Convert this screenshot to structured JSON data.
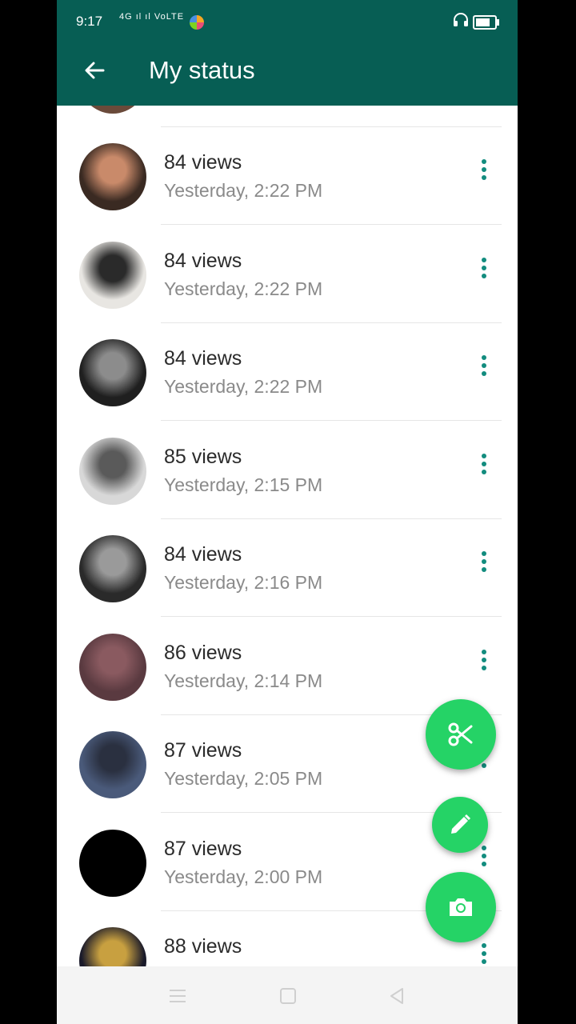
{
  "status_bar": {
    "time": "9:17",
    "signal_text": "4G ıl ıl VoLTE",
    "icons": [
      "signal-icon",
      "app-notification-icon",
      "headset-icon",
      "battery-icon"
    ]
  },
  "app_bar": {
    "title": "My status",
    "back_icon": "arrow-left-icon"
  },
  "statuses": [
    {
      "views": "84 views",
      "time": "Yesterday, 2:22 PM",
      "avatar_colors": [
        "#3a2a22",
        "#c98a6a"
      ]
    },
    {
      "views": "84 views",
      "time": "Yesterday, 2:22 PM",
      "avatar_colors": [
        "#e8e6e2",
        "#2a2a2a"
      ]
    },
    {
      "views": "84 views",
      "time": "Yesterday, 2:22 PM",
      "avatar_colors": [
        "#1f1f1f",
        "#8c8c8c"
      ]
    },
    {
      "views": "85 views",
      "time": "Yesterday, 2:15 PM",
      "avatar_colors": [
        "#d8d8d8",
        "#5a5a5a"
      ]
    },
    {
      "views": "84 views",
      "time": "Yesterday, 2:16 PM",
      "avatar_colors": [
        "#2a2a2a",
        "#9a9a9a"
      ]
    },
    {
      "views": "86 views",
      "time": "Yesterday, 2:14 PM",
      "avatar_colors": [
        "#5a3a40",
        "#8a5a60"
      ]
    },
    {
      "views": "87 views",
      "time": "Yesterday, 2:05 PM",
      "avatar_colors": [
        "#4a5a7a",
        "#2a3040"
      ]
    },
    {
      "views": "87 views",
      "time": "Yesterday, 2:00 PM",
      "avatar_colors": [
        "#000000",
        "#000000"
      ]
    },
    {
      "views": "88 views",
      "time": "",
      "avatar_colors": [
        "#1a1a2a",
        "#c8a040"
      ]
    }
  ],
  "fabs": {
    "cut": "scissors-icon",
    "edit": "pencil-icon",
    "camera": "camera-icon"
  },
  "colors": {
    "header": "#075e54",
    "accent": "#25d366",
    "menu_dots": "#128c7e"
  }
}
